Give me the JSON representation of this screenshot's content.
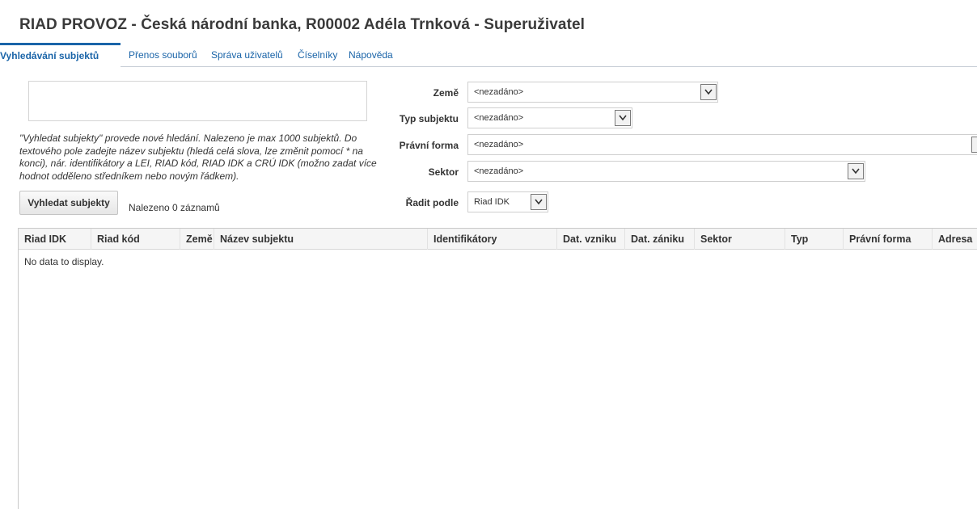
{
  "header": {
    "title": "RIAD PROVOZ  -  Česká národní banka, R00002 Adéla Trnková  -  Superuživatel"
  },
  "tabs": [
    {
      "label": "Vyhledávání subjektů",
      "active": true
    },
    {
      "label": "Přenos souborů",
      "active": false
    },
    {
      "label": "Správa uživatelů",
      "active": false
    },
    {
      "label": "Číselníky",
      "active": false
    },
    {
      "label": "Nápověda",
      "active": false
    }
  ],
  "search": {
    "value": "",
    "help_text": "\"Vyhledat subjekty\" provede nové hledání. Nalezeno je max 1000 subjektů. Do textového pole zadejte název subjektu (hledá celá slova, lze změnit pomocí * na konci), nár. identifikátory a LEI, RIAD kód, RIAD IDK a CRÚ IDK (možno zadat více hodnot odděleno středníkem nebo novým řádkem).",
    "button_label": "Vyhledat subjekty",
    "result_count": "Nalezeno 0 záznamů"
  },
  "filters": {
    "country": {
      "label": "Země",
      "value": "<nezadáno>"
    },
    "subject_type": {
      "label": "Typ subjektu",
      "value": "<nezadáno>"
    },
    "legal_form": {
      "label": "Právní forma",
      "value": "<nezadáno>"
    },
    "sector": {
      "label": "Sektor",
      "value": "<nezadáno>"
    },
    "sort_by": {
      "label": "Řadit podle",
      "value": "Riad IDK"
    }
  },
  "table": {
    "columns": [
      "Riad IDK",
      "Riad kód",
      "Země",
      "Název subjektu",
      "Identifikátory",
      "Dat. vzniku",
      "Dat. zániku",
      "Sektor",
      "Typ",
      "Právní forma",
      "Adresa"
    ],
    "empty_text": "No data to display."
  }
}
